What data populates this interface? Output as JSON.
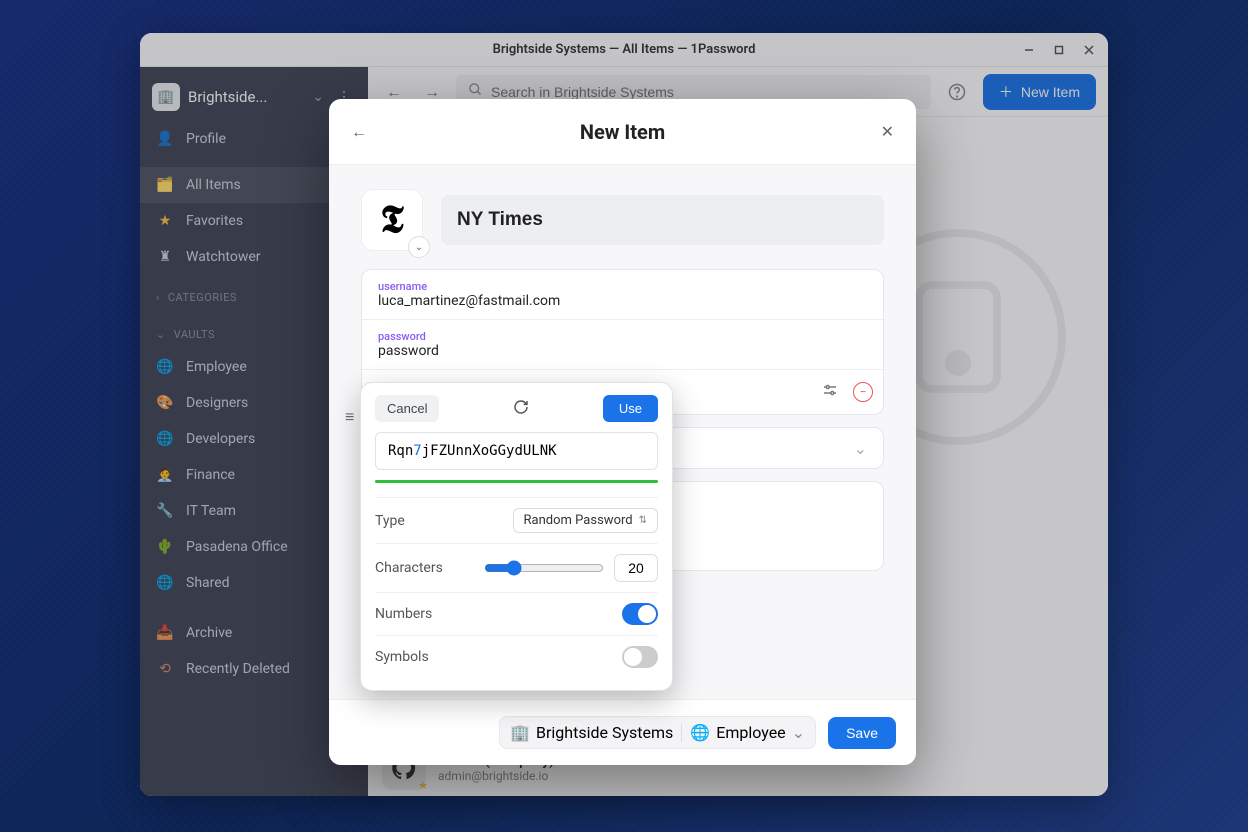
{
  "window": {
    "title": "Brightside Systems — All Items — 1Password"
  },
  "sidebar": {
    "account": "Brightside...",
    "nav": {
      "profile": "Profile",
      "all_items": "All Items",
      "favorites": "Favorites",
      "watchtower": "Watchtower"
    },
    "categories_label": "Categories",
    "vaults_label": "Vaults",
    "vaults": {
      "employee": "Employee",
      "designers": "Designers",
      "developers": "Developers",
      "finance": "Finance",
      "it_team": "IT Team",
      "pasadena": "Pasadena Office",
      "shared": "Shared"
    },
    "archive": "Archive",
    "recently_deleted": "Recently Deleted"
  },
  "toolbar": {
    "search_placeholder": "Search in Brightside Systems",
    "new_item": "New Item"
  },
  "modal": {
    "title": "New Item",
    "item_name": "NY Times",
    "username_label": "username",
    "username_value": "luca_martinez@fastmail.com",
    "password_label": "password",
    "password_value": "password"
  },
  "generator": {
    "cancel": "Cancel",
    "use": "Use",
    "password_prefix": "Rqn",
    "password_digit": "7",
    "password_suffix": "jFZUnnXoGGydULNK",
    "type_label": "Type",
    "type_value": "Random Password",
    "chars_label": "Characters",
    "chars_value": "20",
    "numbers_label": "Numbers",
    "symbols_label": "Symbols",
    "numbers_on": true,
    "symbols_on": false
  },
  "footer": {
    "org": "Brightside Systems",
    "vault": "Employee",
    "save": "Save"
  },
  "bottom_item": {
    "title": "GitHub (Company)",
    "subtitle": "admin@brightside.io"
  }
}
